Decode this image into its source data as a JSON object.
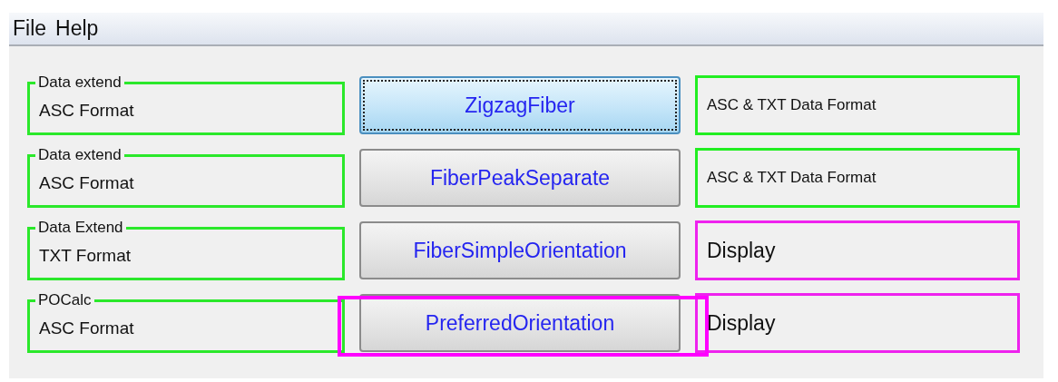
{
  "menu": [
    {
      "label": "File"
    },
    {
      "label": "Help"
    }
  ],
  "rows": [
    {
      "group": {
        "title": "Data extend",
        "text": "ASC  Format"
      },
      "button": {
        "label": "ZigzagFiber",
        "focused": true
      },
      "info": {
        "text": "ASC & TXT Data Format",
        "color": "#22ee22"
      },
      "highlighted": false
    },
    {
      "group": {
        "title": "Data extend",
        "text": "ASC Format"
      },
      "button": {
        "label": "FiberPeakSeparate",
        "focused": false
      },
      "info": {
        "text": "ASC & TXT Data Format",
        "color": "#22ee22"
      },
      "highlighted": false
    },
    {
      "group": {
        "title": "Data Extend",
        "text": "TXT Format"
      },
      "button": {
        "label": "FiberSimpleOrientation",
        "focused": false
      },
      "info": {
        "text": "Display",
        "color": "#ee22ee"
      },
      "highlighted": false
    },
    {
      "group": {
        "title": "POCalc",
        "text": "ASC Format"
      },
      "button": {
        "label": "PreferredOrientation",
        "focused": false
      },
      "info": {
        "text": "Display",
        "color": "#ee22ee"
      },
      "highlighted": true
    }
  ]
}
